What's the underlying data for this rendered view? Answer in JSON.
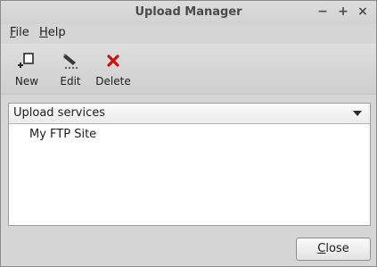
{
  "window": {
    "title": "Upload Manager",
    "controls": {
      "minimize": "−",
      "maximize": "+",
      "close": "×"
    }
  },
  "menubar": {
    "file_mnemonic": "F",
    "file_rest": "ile",
    "help_mnemonic": "H",
    "help_rest": "elp"
  },
  "toolbar": {
    "new_label": "New",
    "new_icon": "new-item-icon",
    "edit_label": "Edit",
    "edit_icon": "pencil-icon",
    "delete_label": "Delete",
    "delete_icon": "red-x-icon",
    "delete_color": "#cc1111"
  },
  "services": {
    "selected": "Upload services",
    "items": [
      "My FTP Site"
    ]
  },
  "footer": {
    "close_mnemonic": "C",
    "close_rest": "lose"
  }
}
